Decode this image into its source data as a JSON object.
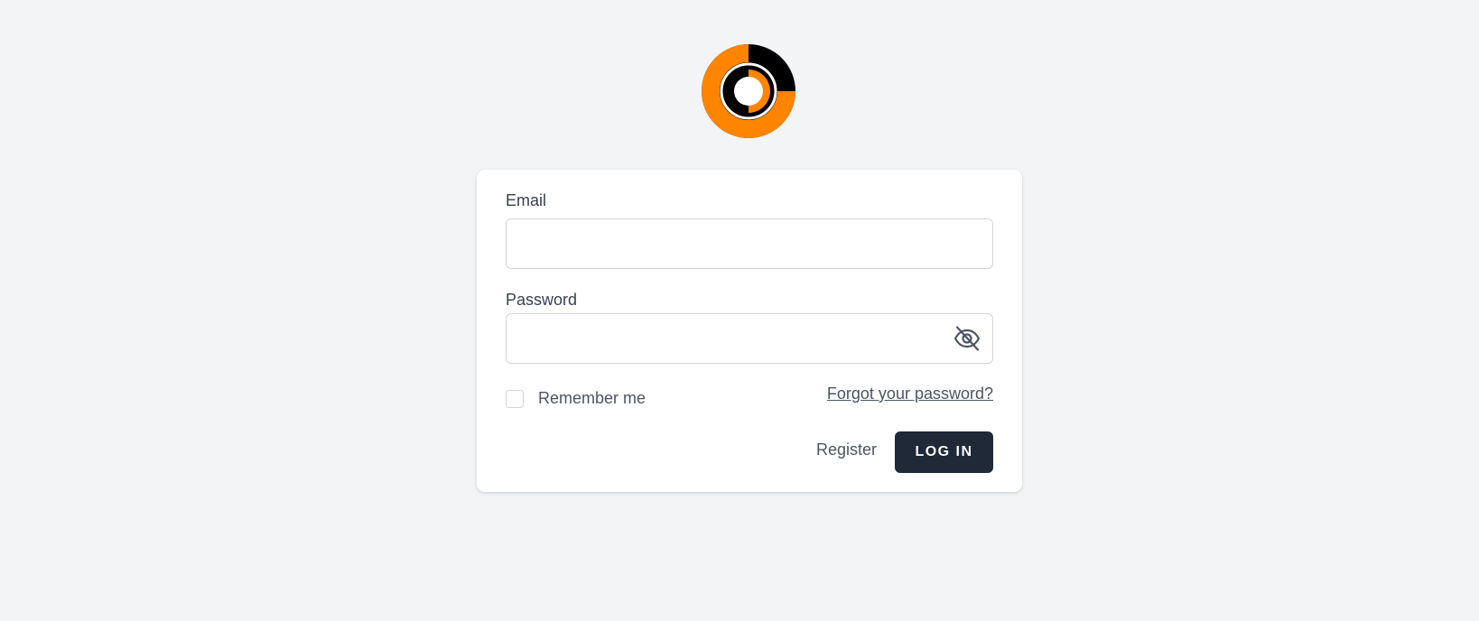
{
  "logo": {
    "icon": "orange-black-ring-logo-icon",
    "colors": {
      "orange": "#ff8400",
      "black": "#000000"
    }
  },
  "form": {
    "email": {
      "label": "Email",
      "value": "",
      "placeholder": ""
    },
    "password": {
      "label": "Password",
      "value": "",
      "placeholder": "",
      "toggle_icon": "eye-off-icon"
    },
    "remember_me": {
      "label": "Remember me",
      "checked": false
    },
    "forgot_link": "Forgot your password?",
    "register_link": "Register",
    "login_button": "LOG IN"
  },
  "colors": {
    "background": "#f3f4f6",
    "card": "#ffffff",
    "button_bg": "#1f2937",
    "text": "#374151"
  }
}
